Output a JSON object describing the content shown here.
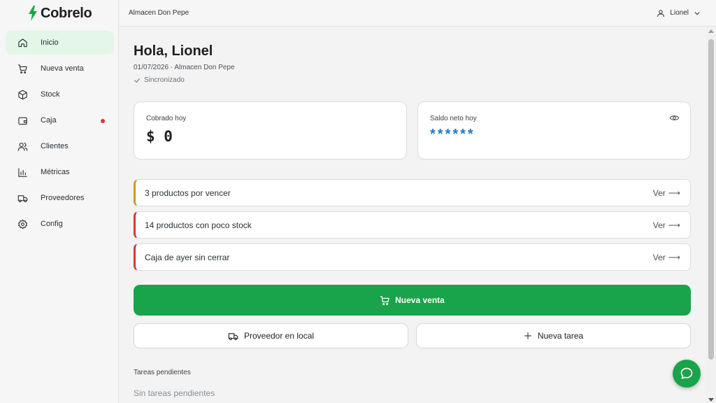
{
  "app": {
    "name": "Cobrelo",
    "accent": "#19a34a"
  },
  "sidebar": {
    "items": [
      {
        "label": "Inicio",
        "icon": "home-icon",
        "active": true
      },
      {
        "label": "Nueva venta",
        "icon": "cart-icon"
      },
      {
        "label": "Stock",
        "icon": "box-icon"
      },
      {
        "label": "Caja",
        "icon": "wallet-icon",
        "badge": "red-dot"
      },
      {
        "label": "Clientes",
        "icon": "users-icon"
      },
      {
        "label": "Métricas",
        "icon": "bar-chart-icon"
      },
      {
        "label": "Proveedores",
        "icon": "truck-icon"
      },
      {
        "label": "Config",
        "icon": "gear-icon"
      }
    ]
  },
  "header": {
    "store_name": "Almacen Don Pepe",
    "user_name": "Lionel"
  },
  "main": {
    "greeting": "Hola, Lionel",
    "subline": "01/07/2026 · Almacen Don Pepe",
    "sync_status": "Sincronizado",
    "cards": {
      "cobrado": {
        "label": "Cobrado hoy",
        "value": "$ 0"
      },
      "saldo": {
        "label": "Saldo neto hoy",
        "value": "******"
      }
    },
    "alerts": [
      {
        "text": "3 productos por vencer",
        "action": "Ver",
        "color": "#d4952a"
      },
      {
        "text": "14 productos con poco stock",
        "action": "Ver",
        "color": "#d43a32"
      },
      {
        "text": "Caja de ayer sin cerrar",
        "action": "Ver",
        "color": "#d43a32"
      }
    ],
    "actions": {
      "primary": "Nueva venta",
      "supplier": "Proveedor en local",
      "task": "Nueva tarea"
    },
    "tasks": {
      "title": "Tareas pendientes",
      "empty": "Sin tareas pendientes"
    }
  }
}
